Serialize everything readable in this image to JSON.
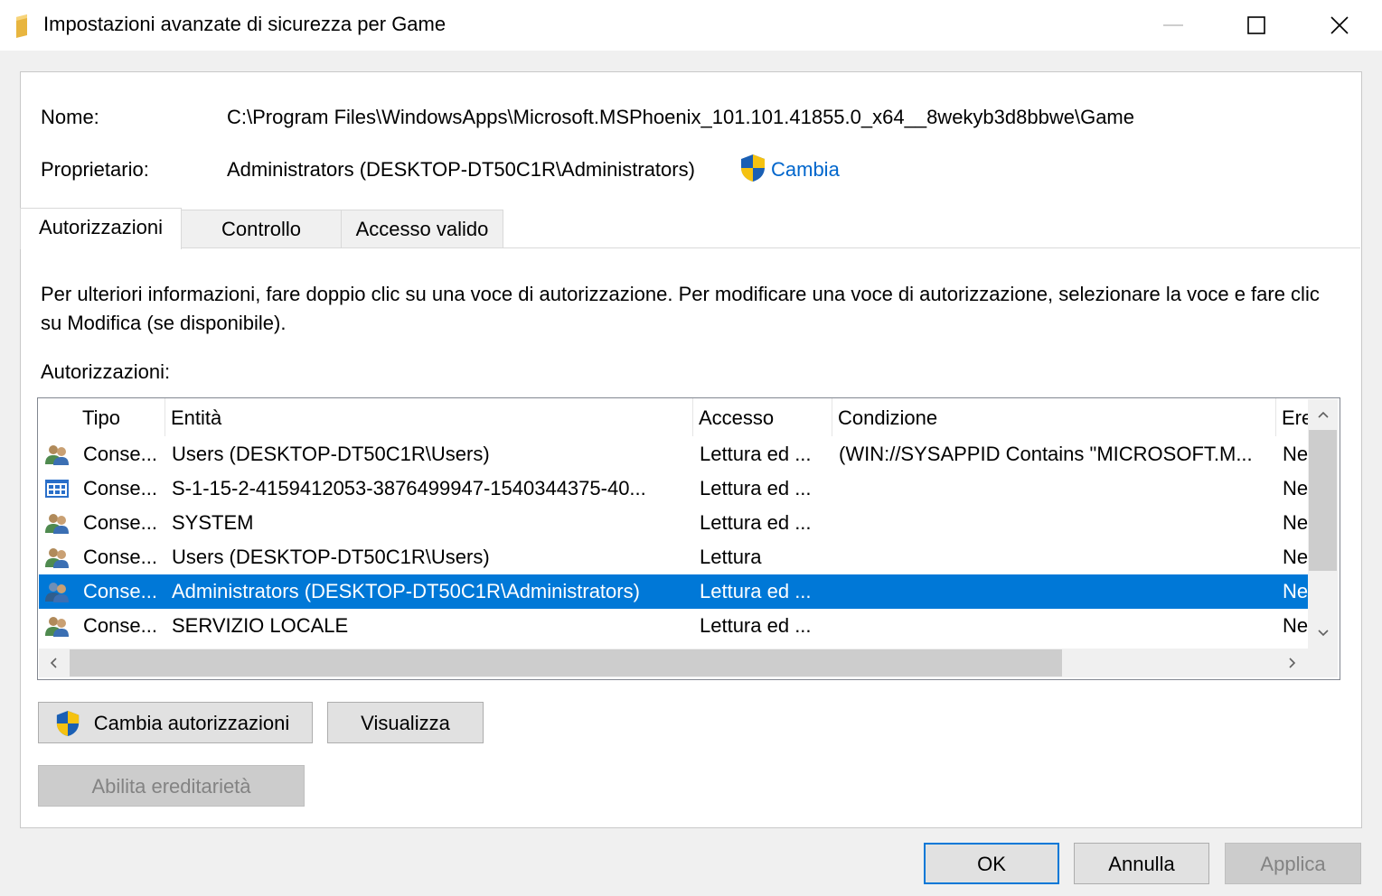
{
  "window": {
    "title": "Impostazioni avanzate di sicurezza per Game",
    "icon": "folder-icon",
    "controls": {
      "minimize": "minimize-icon",
      "maximize": "maximize-icon",
      "close": "close-icon"
    }
  },
  "details": {
    "name_label": "Nome:",
    "name_value": "C:\\Program Files\\WindowsApps\\Microsoft.MSPhoenix_101.101.41855.0_x64__8wekyb3d8bbwe\\Game",
    "owner_label": "Proprietario:",
    "owner_value": "Administrators (DESKTOP-DT50C1R\\Administrators)",
    "change_link": "Cambia"
  },
  "tabs": [
    {
      "label": "Autorizzazioni",
      "active": true
    },
    {
      "label": "Controllo",
      "active": false
    },
    {
      "label": "Accesso valido",
      "active": false
    }
  ],
  "info_text": "Per ulteriori informazioni, fare doppio clic su una voce di autorizzazione. Per modificare una voce di autorizzazione, selezionare la voce e fare clic su Modifica (se disponibile).",
  "permissions_label": "Autorizzazioni:",
  "table": {
    "columns": [
      "Tipo",
      "Entità",
      "Accesso",
      "Condizione",
      "Ere"
    ],
    "rows": [
      {
        "icon": "users-group-icon",
        "type": "Conse...",
        "entity": "Users (DESKTOP-DT50C1R\\Users)",
        "access": "Lettura ed ...",
        "condition": "(WIN://SYSAPPID Contains \"MICROSOFT.M...",
        "inherited": "Ne",
        "selected": false
      },
      {
        "icon": "app-package-icon",
        "type": "Conse...",
        "entity": "S-1-15-2-4159412053-3876499947-1540344375-40...",
        "access": "Lettura ed ...",
        "condition": "",
        "inherited": "Ne",
        "selected": false
      },
      {
        "icon": "users-group-icon",
        "type": "Conse...",
        "entity": "SYSTEM",
        "access": "Lettura ed ...",
        "condition": "",
        "inherited": "Ne",
        "selected": false
      },
      {
        "icon": "users-group-icon",
        "type": "Conse...",
        "entity": "Users (DESKTOP-DT50C1R\\Users)",
        "access": "Lettura",
        "condition": "",
        "inherited": "Ne",
        "selected": false
      },
      {
        "icon": "users-group-icon",
        "type": "Conse...",
        "entity": "Administrators (DESKTOP-DT50C1R\\Administrators)",
        "access": "Lettura ed ...",
        "condition": "",
        "inherited": "Ne",
        "selected": true
      },
      {
        "icon": "users-group-icon",
        "type": "Conse...",
        "entity": "SERVIZIO LOCALE",
        "access": "Lettura ed ...",
        "condition": "",
        "inherited": "Ne",
        "selected": false
      }
    ]
  },
  "buttons": {
    "change_permissions": "Cambia autorizzazioni",
    "view": "Visualizza",
    "enable_inheritance": "Abilita ereditarietà",
    "ok": "OK",
    "cancel": "Annulla",
    "apply": "Applica"
  },
  "colors": {
    "selection": "#0078d7",
    "link": "#0066cc",
    "shield_blue": "#1a5fb4",
    "shield_yellow": "#f5c211"
  }
}
